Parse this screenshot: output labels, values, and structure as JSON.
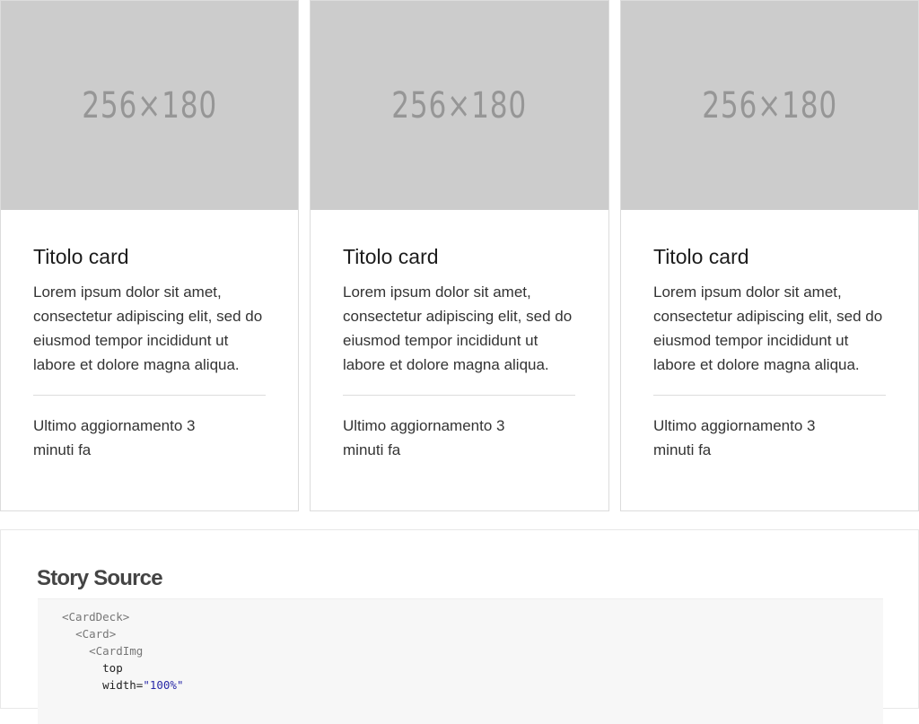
{
  "cards": [
    {
      "image_label": "256×180",
      "title": "Titolo card",
      "text": "Lorem ipsum dolor sit amet, consectetur adipiscing elit, sed do eiusmod tempor incididunt ut labore et dolore magna aliqua.",
      "footer": "Ultimo aggiornamento 3 minuti fa"
    },
    {
      "image_label": "256×180",
      "title": "Titolo card",
      "text": "Lorem ipsum dolor sit amet, consectetur adipiscing elit, sed do eiusmod tempor incididunt ut labore et dolore magna aliqua.",
      "footer": "Ultimo aggiornamento 3 minuti fa"
    },
    {
      "image_label": "256×180",
      "title": "Titolo card",
      "text": "Lorem ipsum dolor sit amet, consectetur adipiscing elit, sed do eiusmod tempor incididunt ut labore et dolore magna aliqua.",
      "footer": "Ultimo aggiornamento 3 minuti fa"
    }
  ],
  "story": {
    "title": "Story Source",
    "code_lines": [
      {
        "tag": "<CardDeck>"
      },
      {
        "tag": "<Card>"
      },
      {
        "tag": "<CardImg"
      },
      {
        "attr": "top"
      },
      {
        "attr": "width=",
        "str": "\"100%\""
      }
    ]
  },
  "colors": {
    "image_placeholder_bg": "#cccccc",
    "image_placeholder_text": "#969696",
    "border": "#dcdcdc",
    "code_bg": "#f7f7f7",
    "string_color": "#2a2aa8"
  }
}
